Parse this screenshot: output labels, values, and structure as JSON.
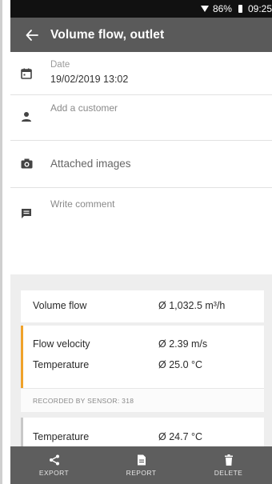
{
  "status_bar": {
    "battery": "86%",
    "time": "09:25"
  },
  "app_bar": {
    "title": "Volume flow, outlet",
    "back_icon": "arrow-left-icon"
  },
  "fields": {
    "date": {
      "label": "Date",
      "value": "19/02/2019 13:02",
      "icon": "calendar-icon"
    },
    "customer": {
      "placeholder": "Add a customer",
      "icon": "person-icon"
    },
    "images": {
      "label": "Attached images",
      "icon": "camera-icon"
    },
    "comment": {
      "placeholder": "Write comment",
      "icon": "comment-icon"
    }
  },
  "results": [
    {
      "label": "Volume flow",
      "value": "Ø 1,032.5 m³/h"
    },
    {
      "label": "Flow velocity",
      "value": "Ø 2.39 m/s"
    },
    {
      "label": "Temperature",
      "value": "Ø 25.0 °C"
    },
    {
      "label": "Temperature",
      "value": "Ø 24.7 °C"
    }
  ],
  "sensor": {
    "text": "RECORDED BY SENSOR:  318"
  },
  "bottom_bar": {
    "export": "EXPORT",
    "report": "REPORT",
    "delete": "DELETE"
  },
  "colors": {
    "app_bar": "#5a5a5a",
    "accent": "#f0a22a",
    "bottom_bar": "#5e5e5e"
  }
}
